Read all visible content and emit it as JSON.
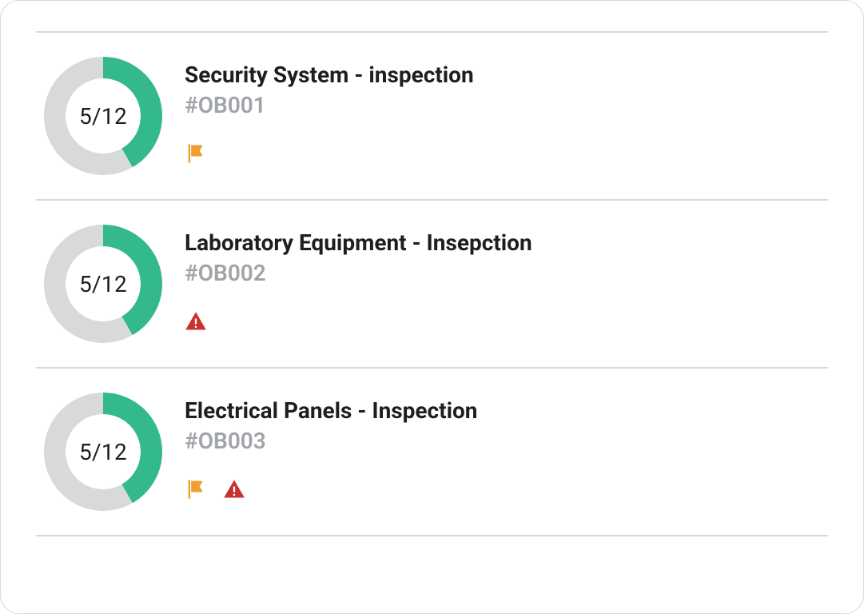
{
  "colors": {
    "accent": "#34b98b",
    "muted": "#a0a3a8",
    "flag": "#ef9e30",
    "alert": "#c93030",
    "divider": "#d7d9db"
  },
  "items": [
    {
      "title": "Security System - inspection",
      "code": "#OB001",
      "progress_label": "5/12",
      "progress_done": 5,
      "progress_total": 12,
      "has_flag": true,
      "has_alert": false
    },
    {
      "title": "Laboratory Equipment - Insepction",
      "code": "#OB002",
      "progress_label": "5/12",
      "progress_done": 5,
      "progress_total": 12,
      "has_flag": false,
      "has_alert": true
    },
    {
      "title": "Electrical Panels - Inspection",
      "code": "#OB003",
      "progress_label": "5/12",
      "progress_done": 5,
      "progress_total": 12,
      "has_flag": true,
      "has_alert": true
    }
  ]
}
